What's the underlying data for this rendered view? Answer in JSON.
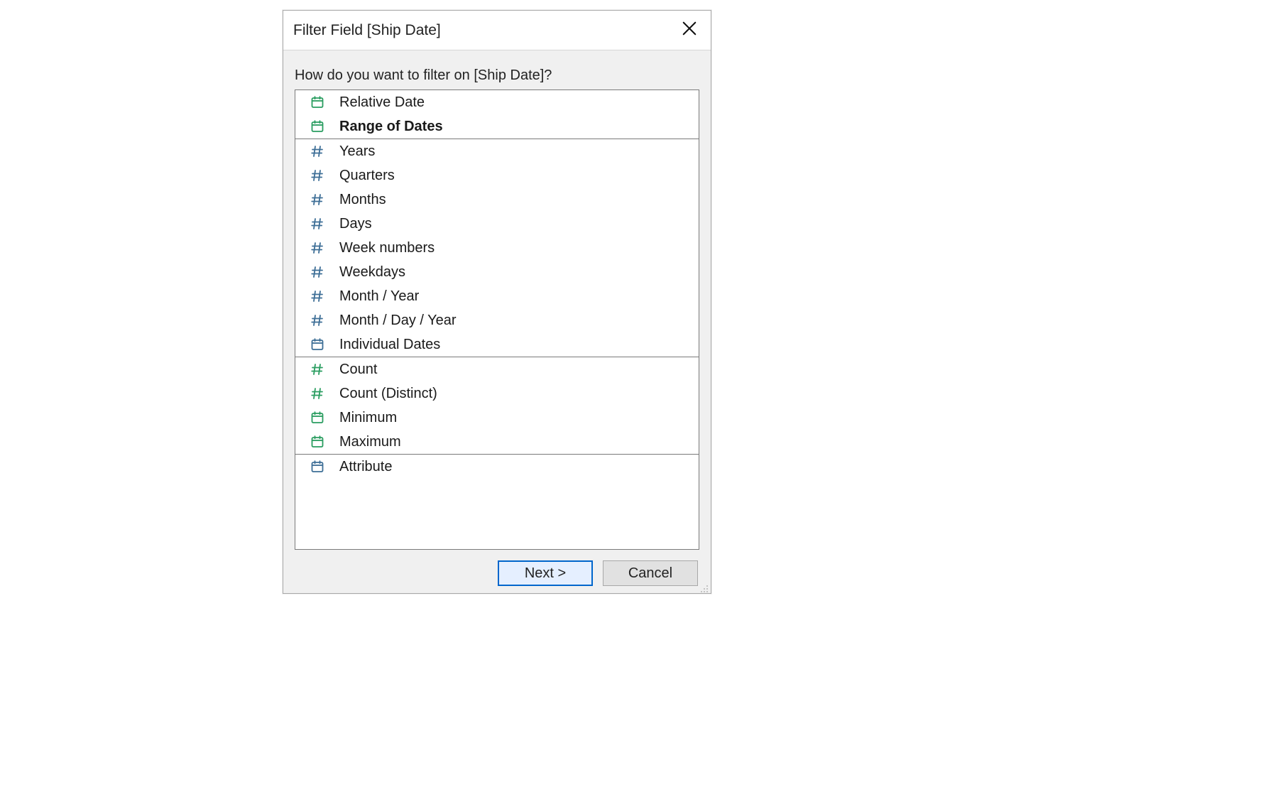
{
  "dialog": {
    "title": "Filter Field [Ship Date]",
    "prompt": "How do you want to filter on [Ship Date]?",
    "next_label": "Next >",
    "cancel_label": "Cancel"
  },
  "sections": [
    {
      "items": [
        {
          "icon": "calendar-green",
          "label": "Relative Date",
          "selected": false
        },
        {
          "icon": "calendar-green",
          "label": "Range of Dates",
          "selected": true
        }
      ]
    },
    {
      "items": [
        {
          "icon": "hash-blue",
          "label": "Years",
          "selected": false
        },
        {
          "icon": "hash-blue",
          "label": "Quarters",
          "selected": false
        },
        {
          "icon": "hash-blue",
          "label": "Months",
          "selected": false
        },
        {
          "icon": "hash-blue",
          "label": "Days",
          "selected": false
        },
        {
          "icon": "hash-blue",
          "label": "Week numbers",
          "selected": false
        },
        {
          "icon": "hash-blue",
          "label": "Weekdays",
          "selected": false
        },
        {
          "icon": "hash-blue",
          "label": "Month / Year",
          "selected": false
        },
        {
          "icon": "hash-blue",
          "label": "Month / Day / Year",
          "selected": false
        },
        {
          "icon": "calendar-blue",
          "label": "Individual Dates",
          "selected": false
        }
      ]
    },
    {
      "items": [
        {
          "icon": "hash-green",
          "label": "Count",
          "selected": false
        },
        {
          "icon": "hash-green",
          "label": "Count (Distinct)",
          "selected": false
        },
        {
          "icon": "calendar-green",
          "label": "Minimum",
          "selected": false
        },
        {
          "icon": "calendar-green",
          "label": "Maximum",
          "selected": false
        }
      ]
    },
    {
      "items": [
        {
          "icon": "calendar-blue",
          "label": "Attribute",
          "selected": false
        }
      ]
    }
  ],
  "colors": {
    "green": "#2a9d60",
    "blue": "#3d6e96"
  }
}
